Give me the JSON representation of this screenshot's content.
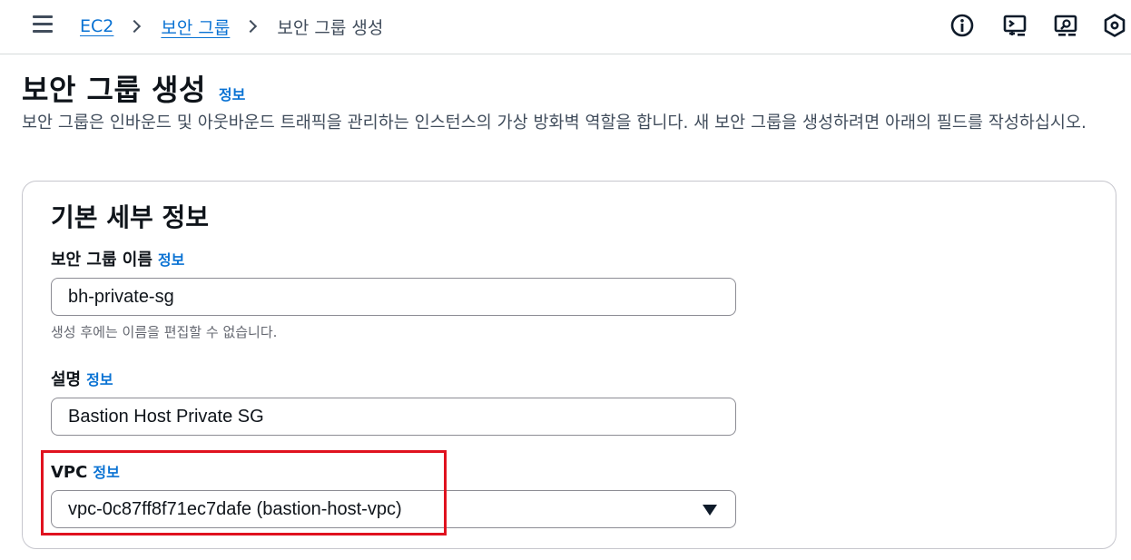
{
  "breadcrumb": {
    "items": [
      "EC2",
      "보안 그룹"
    ],
    "current": "보안 그룹 생성"
  },
  "top_icons": [
    "info-circle-icon",
    "cloudshell-icon",
    "screen-search-icon",
    "settings-hex-icon"
  ],
  "page": {
    "title": "보안 그룹 생성",
    "info": "정보",
    "description": "보안 그룹은 인바운드 및 아웃바운드 트래픽을 관리하는 인스턴스의 가상 방화벽 역할을 합니다. 새 보안 그룹을 생성하려면 아래의 필드를 작성하십시오."
  },
  "basic_details": {
    "title": "기본 세부 정보",
    "name_field": {
      "label": "보안 그룹 이름",
      "info": "정보",
      "value": "bh-private-sg",
      "hint": "생성 후에는 이름을 편집할 수 없습니다."
    },
    "description_field": {
      "label": "설명",
      "info": "정보",
      "value": "Bastion Host Private SG"
    },
    "vpc_field": {
      "label": "VPC",
      "info": "정보",
      "value": "vpc-0c87ff8f71ec7dafe (bastion-host-vpc)"
    }
  },
  "colors": {
    "link": "#0972d3",
    "highlight": "#e0121f",
    "text": "#0f141a"
  }
}
